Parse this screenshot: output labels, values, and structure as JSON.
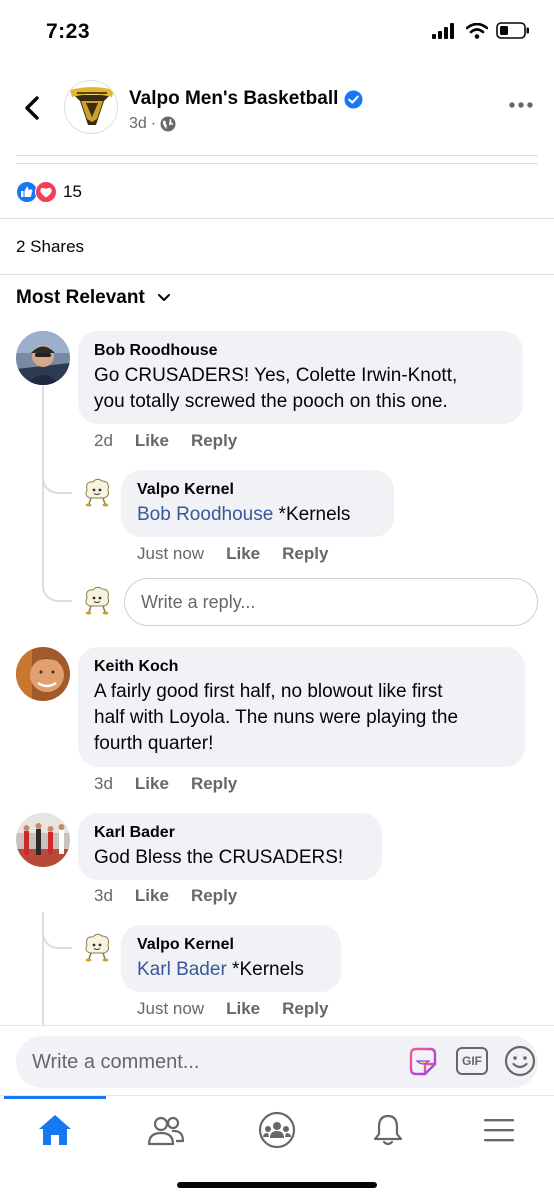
{
  "status_bar": {
    "time": "7:23"
  },
  "post": {
    "page_name": "Valpo Men's Basketball",
    "meta_time": "3d",
    "meta_separator": "·",
    "reaction_count": "15",
    "shares": "2 Shares"
  },
  "comments_section": {
    "sort_label": "Most Relevant",
    "comments": [
      {
        "author": "Bob Roodhouse",
        "lines": [
          "Go CRUSADERS!  Yes, Colette Irwin-Knott,",
          "you totally screwed the pooch on this one."
        ],
        "time": "2d",
        "like": "Like",
        "reply": "Reply",
        "replies": [
          {
            "author": "Valpo Kernel",
            "mention": "Bob Roodhouse",
            "text": " *Kernels",
            "time": "Just now",
            "like": "Like",
            "reply": "Reply"
          }
        ]
      },
      {
        "author": "Keith Koch",
        "lines": [
          "A fairly good first half, no blowout like first",
          "half with Loyola. The nuns were playing the",
          "fourth quarter!"
        ],
        "time": "3d",
        "like": "Like",
        "reply": "Reply"
      },
      {
        "author": "Karl Bader",
        "lines": [
          "God Bless the CRUSADERS!"
        ],
        "time": "3d",
        "like": "Like",
        "reply": "Reply",
        "replies": [
          {
            "author": "Valpo Kernel",
            "mention": "Karl Bader",
            "text": " *Kernels",
            "time": "Just now",
            "like": "Like",
            "reply": "Reply"
          }
        ]
      }
    ],
    "reply_placeholder": "Write a reply..."
  },
  "composer": {
    "placeholder": "Write a comment...",
    "gif_label": "GIF"
  },
  "colors": {
    "accent": "#1877f2",
    "mention": "#385898",
    "bubble": "#f0f2f5",
    "secondary_text": "#65676b"
  },
  "icons": [
    "back-chevron-icon",
    "verified-badge-icon",
    "globe-icon",
    "more-icon",
    "like-reaction-icon",
    "love-reaction-icon",
    "chevron-down-icon",
    "sticker-icon",
    "gif-icon",
    "emoji-icon",
    "home-icon",
    "friends-icon",
    "groups-icon",
    "bell-icon",
    "menu-icon"
  ]
}
